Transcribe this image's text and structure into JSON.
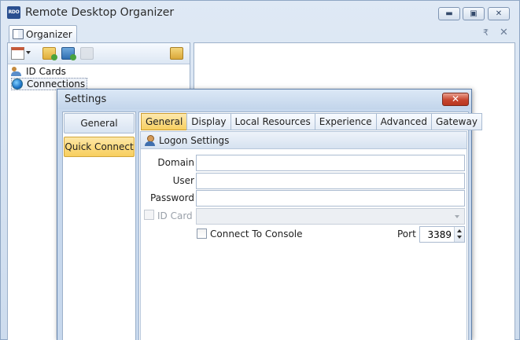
{
  "window": {
    "app_icon_text": "RDO",
    "title": "Remote Desktop Organizer",
    "minimize_glyph": "▬",
    "maximize_glyph": "▣",
    "close_glyph": "✕"
  },
  "doc_tab": {
    "label": "Organizer",
    "pin_glyph": "₹",
    "close_glyph": "✕"
  },
  "toolbar": {
    "icons": [
      "new-item-icon",
      "dropdown-arrow-icon",
      "new-folder-icon",
      "new-connection-icon",
      "disabled-action-icon",
      "lock-icon"
    ]
  },
  "tree": {
    "items": [
      {
        "label": "ID Cards",
        "icon": "people-icon"
      },
      {
        "label": "Connections",
        "icon": "globe-icon"
      }
    ]
  },
  "dialog": {
    "title": "Settings",
    "close_glyph": "✕",
    "nav": [
      {
        "label": "General",
        "selected": false
      },
      {
        "label": "Quick Connect",
        "selected": true
      }
    ],
    "tabs": [
      {
        "label": "General",
        "active": true
      },
      {
        "label": "Display",
        "active": false
      },
      {
        "label": "Local Resources",
        "active": false
      },
      {
        "label": "Experience",
        "active": false
      },
      {
        "label": "Advanced",
        "active": false
      },
      {
        "label": "Gateway",
        "active": false
      }
    ],
    "group_title": "Logon Settings",
    "fields": {
      "domain_label": "Domain",
      "domain_value": "",
      "user_label": "User",
      "user_value": "",
      "password_label": "Password",
      "password_value": "",
      "idcard_label": "ID Card",
      "idcard_value": "",
      "idcard_enabled": false,
      "console_label": "Connect To Console",
      "console_checked": false,
      "port_label": "Port",
      "port_value": "3389"
    }
  },
  "colors": {
    "accent_tab": "#f7cf61",
    "window_frame": "#c9d9ec",
    "close_button": "#c7452e"
  }
}
